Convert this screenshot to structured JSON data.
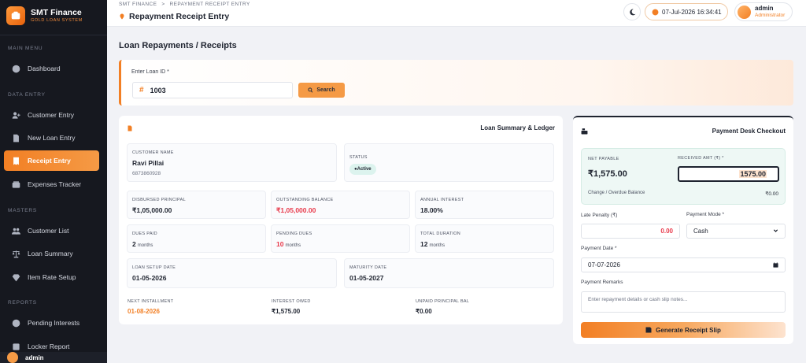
{
  "brand": {
    "name": "SMT Finance",
    "subtitle": "GOLD LOAN SYSTEM"
  },
  "sidebar": {
    "sections": {
      "main": "MAIN MENU",
      "data": "DATA ENTRY",
      "masters": "MASTERS",
      "reports": "REPORTS"
    },
    "items": [
      {
        "label": "Dashboard",
        "icon": "dashboard-icon"
      },
      {
        "label": "Customer Entry",
        "icon": "user-plus-icon"
      },
      {
        "label": "New Loan Entry",
        "icon": "document-icon"
      },
      {
        "label": "Receipt Entry",
        "icon": "receipt-icon",
        "active": true
      },
      {
        "label": "Expenses Tracker",
        "icon": "wallet-icon"
      },
      {
        "label": "Customer List",
        "icon": "users-icon"
      },
      {
        "label": "Loan Summary",
        "icon": "scale-icon"
      },
      {
        "label": "Item Rate Setup",
        "icon": "gem-icon"
      },
      {
        "label": "Pending Interests",
        "icon": "clock-icon"
      },
      {
        "label": "Locker Report",
        "icon": "locker-icon"
      }
    ],
    "user": "admin"
  },
  "topbar": {
    "breadcrumb": [
      "SMT FINANCE",
      "REPAYMENT RECEIPT ENTRY"
    ],
    "breadcrumb_sep": ">",
    "title": "Repayment Receipt Entry",
    "datetime": "07-Jul-2026 16:34:41",
    "user_name": "admin",
    "user_role": "Administrator"
  },
  "main": {
    "section_title": "Loan Repayments / Receipts",
    "search": {
      "label": "Enter Loan ID *",
      "prefix": "#",
      "value": "1003",
      "button": "Search"
    },
    "ledger": {
      "title": "Loan Summary & Ledger",
      "customer_name_label": "CUSTOMER NAME",
      "customer_name": "Ravi Pillai",
      "customer_phone": "6873860928",
      "status_label": "STATUS",
      "status": "●Active",
      "disbursed_label": "DISBURSED PRINCIPAL",
      "disbursed": "₹1,05,000.00",
      "outstanding_label": "OUTSTANDING BALANCE",
      "outstanding": "₹1,05,000.00",
      "interest_label": "ANNUAL INTEREST",
      "interest": "18.00%",
      "dues_paid_label": "DUES PAID",
      "dues_paid": "2",
      "pending_dues_label": "PENDING DUES",
      "pending_dues": "10",
      "duration_label": "TOTAL DURATION",
      "duration": "12",
      "months_unit": "months",
      "setup_date_label": "LOAN SETUP DATE",
      "setup_date": "01-05-2026",
      "maturity_label": "MATURITY DATE",
      "maturity": "01-05-2027",
      "next_inst_label": "NEXT INSTALLMENT",
      "next_inst": "01-08-2026",
      "interest_owed_label": "INTEREST OWED",
      "interest_owed": "₹1,575.00",
      "unpaid_principal_label": "UNPAID PRINCIPAL BAL",
      "unpaid_principal": "₹0.00"
    },
    "payment": {
      "title": "Payment Desk Checkout",
      "net_payable_label": "NET PAYABLE",
      "net_payable": "₹1,575.00",
      "received_label": "RECEIVED AMT (₹) *",
      "received": "1575.00",
      "change_label": "Change / Overdue Balance",
      "change": "₹0.00",
      "penalty_label": "Late Penalty (₹)",
      "penalty": "0.00",
      "mode_label": "Payment Mode *",
      "mode": "Cash",
      "date_label": "Payment Date *",
      "date": "07-07-2026",
      "remarks_label": "Payment Remarks",
      "remarks_placeholder": "Enter repayment details or cash slip notes...",
      "button": "Generate Receipt Slip"
    }
  },
  "colors": {
    "accent": "#f27f24",
    "sidebar": "#16181f",
    "danger": "#e8394a"
  }
}
